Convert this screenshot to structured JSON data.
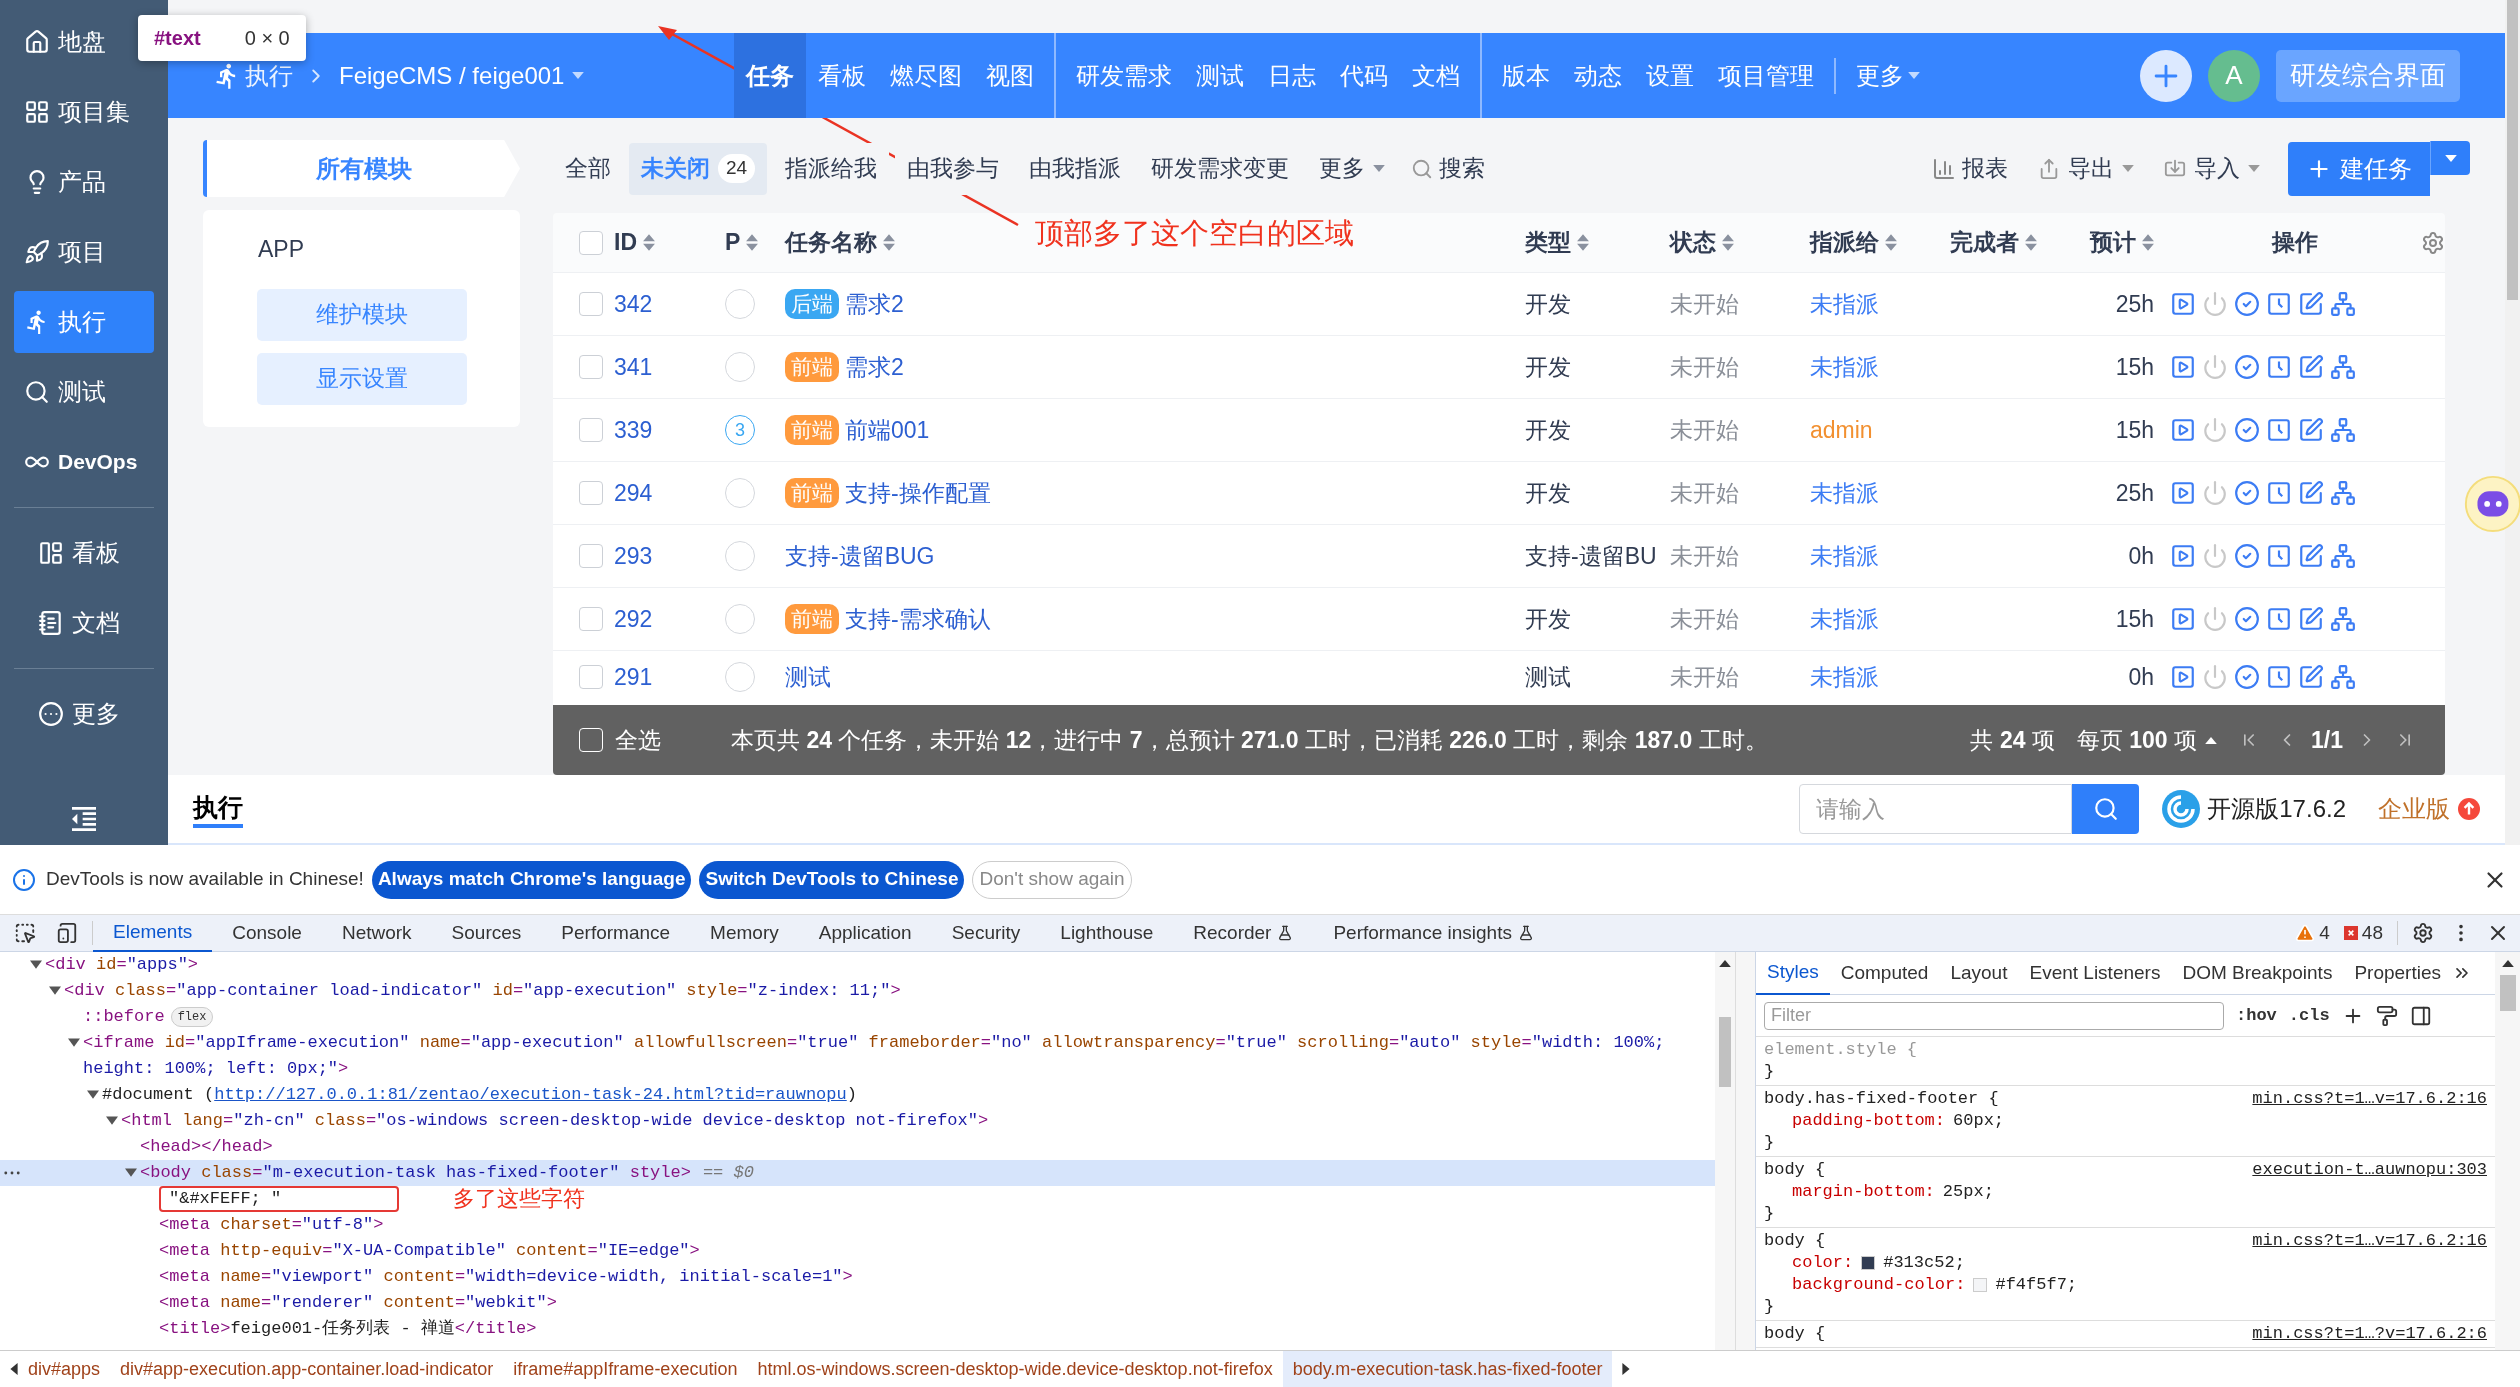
{
  "tooltip": {
    "node": "#text",
    "size": "0 × 0"
  },
  "sidebar": {
    "groups": [
      [
        {
          "label": "地盘",
          "selected": false
        },
        {
          "label": "项目集",
          "selected": false
        },
        {
          "label": "产品",
          "selected": false
        },
        {
          "label": "项目",
          "selected": false
        },
        {
          "label": "执行",
          "selected": true
        },
        {
          "label": "测试",
          "selected": false
        },
        {
          "label": "DevOps",
          "selected": false
        }
      ],
      [
        {
          "label": "看板",
          "selected": false
        },
        {
          "label": "文档",
          "selected": false
        }
      ],
      [
        {
          "label": "更多",
          "selected": false
        }
      ]
    ]
  },
  "header": {
    "module": "执行",
    "project": "FeigeCMS / feige001",
    "nav": [
      [
        {
          "label": "任务",
          "selected": true
        },
        {
          "label": "看板",
          "selected": false
        },
        {
          "label": "燃尽图",
          "selected": false
        },
        {
          "label": "视图",
          "selected": false
        }
      ],
      [
        {
          "label": "研发需求",
          "selected": false
        },
        {
          "label": "测试",
          "selected": false
        },
        {
          "label": "日志",
          "selected": false
        },
        {
          "label": "代码",
          "selected": false
        },
        {
          "label": "文档",
          "selected": false
        }
      ],
      [
        {
          "label": "版本",
          "selected": false
        },
        {
          "label": "动态",
          "selected": false
        },
        {
          "label": "设置",
          "selected": false
        },
        {
          "label": "项目管理",
          "selected": false
        }
      ]
    ],
    "more": "更多",
    "avatar": "A",
    "switch_button": "研发综合界面"
  },
  "annotation": "顶部多了这个空白的区域",
  "modules": {
    "tab": "所有模块",
    "items": [
      "APP"
    ],
    "buttons": [
      "维护模块",
      "显示设置"
    ]
  },
  "filters": [
    {
      "label": "全部",
      "selected": false
    },
    {
      "label": "未关闭",
      "count": "24",
      "selected": true
    },
    {
      "label": "指派给我",
      "selected": false
    },
    {
      "label": "由我参与",
      "selected": false
    },
    {
      "label": "由我指派",
      "selected": false
    },
    {
      "label": "研发需求变更",
      "selected": false
    }
  ],
  "filter_more": "更多",
  "search": "搜索",
  "actions": {
    "report": "报表",
    "export": "导出",
    "import": "导入",
    "create": "建任务"
  },
  "table": {
    "columns": [
      {
        "label": "ID",
        "sortable": true
      },
      {
        "label": "P",
        "sortable": true
      },
      {
        "label": "任务名称",
        "sortable": true
      },
      {
        "label": "类型",
        "sortable": true
      },
      {
        "label": "状态",
        "sortable": true
      },
      {
        "label": "指派给",
        "sortable": true
      },
      {
        "label": "完成者",
        "sortable": true
      },
      {
        "label": "预计",
        "sortable": true
      },
      {
        "label": "操作",
        "sortable": false
      }
    ],
    "select_all_checked": false,
    "rows": [
      {
        "id": "342",
        "checked": false,
        "tag": {
          "label": "后端",
          "color": "#3aa7f2"
        },
        "name": "需求2",
        "type": "开发",
        "status": "未开始",
        "assignee": {
          "name": "未指派",
          "color": "#3c7cf4"
        },
        "estimate": "25h"
      },
      {
        "id": "341",
        "checked": false,
        "tag": {
          "label": "前端",
          "color": "#ff9a3d"
        },
        "name": "需求2",
        "type": "开发",
        "status": "未开始",
        "assignee": {
          "name": "未指派",
          "color": "#3c7cf4"
        },
        "estimate": "15h"
      },
      {
        "id": "339",
        "checked": false,
        "priority": "3",
        "tag": {
          "label": "前端",
          "color": "#ff9a3d"
        },
        "name": "前端001",
        "type": "开发",
        "status": "未开始",
        "assignee": {
          "name": "admin",
          "color": "#f29030"
        },
        "estimate": "15h"
      },
      {
        "id": "294",
        "checked": false,
        "tag": {
          "label": "前端",
          "color": "#ff9a3d"
        },
        "name": "支持-操作配置",
        "type": "开发",
        "status": "未开始",
        "assignee": {
          "name": "未指派",
          "color": "#3c7cf4"
        },
        "estimate": "25h"
      },
      {
        "id": "293",
        "checked": false,
        "name": "支持-遗留BUG",
        "type": "支持-遗留BU",
        "status": "未开始",
        "assignee": {
          "name": "未指派",
          "color": "#3c7cf4"
        },
        "estimate": "0h"
      },
      {
        "id": "292",
        "checked": false,
        "tag": {
          "label": "前端",
          "color": "#ff9a3d"
        },
        "name": "支持-需求确认",
        "type": "开发",
        "status": "未开始",
        "assignee": {
          "name": "未指派",
          "color": "#3c7cf4"
        },
        "estimate": "15h"
      },
      {
        "id": "291",
        "checked": false,
        "name": "测试",
        "type": "测试",
        "status": "未开始",
        "assignee": {
          "name": "未指派",
          "color": "#3c7cf4"
        },
        "estimate": "0h"
      }
    ]
  },
  "table_footer": {
    "select_all": "全选",
    "checked": false,
    "summary": "本页共 **24** 个任务，未开始 **12**，进行中 **7**，总预计 **271.0** 工时，已消耗 **226.0** 工时，剩余 **187.0** 工时。",
    "total": "共 **24** 项",
    "per_page": "每页 **100** 项",
    "page": "1/1"
  },
  "footer": {
    "tab": "执行",
    "search_placeholder": "请输入",
    "edition": "开源版17.6.2",
    "upgrade": "企业版"
  },
  "devtools": {
    "infobar": {
      "message": "DevTools is now available in Chinese!",
      "buttons": [
        {
          "label": "Always match Chrome's language",
          "kind": "primary"
        },
        {
          "label": "Switch DevTools to Chinese",
          "kind": "primary"
        },
        {
          "label": "Don't show again",
          "kind": "secondary"
        }
      ]
    },
    "tabs": [
      {
        "label": "Elements",
        "selected": true
      },
      {
        "label": "Console",
        "selected": false
      },
      {
        "label": "Network",
        "selected": false
      },
      {
        "label": "Sources",
        "selected": false
      },
      {
        "label": "Performance",
        "selected": false
      },
      {
        "label": "Memory",
        "selected": false
      },
      {
        "label": "Application",
        "selected": false
      },
      {
        "label": "Security",
        "selected": false
      },
      {
        "label": "Lighthouse",
        "selected": false
      },
      {
        "label": "Recorder",
        "selected": false,
        "experimental": true
      },
      {
        "label": "Performance insights",
        "selected": false,
        "experimental": true
      }
    ],
    "warnings": "4",
    "errors": "48",
    "dom": [
      {
        "kind": "tag",
        "text": "<div id=\"apps\">",
        "expanded": true,
        "children": [
          {
            "kind": "tag",
            "text": "<div class=\"app-container load-indicator\" id=\"app-execution\" style=\"z-index: 11;\">",
            "expanded": true,
            "children": [
              {
                "kind": "pseudo",
                "text": "::before",
                "badge": "flex"
              },
              {
                "kind": "tag",
                "text": "<iframe id=\"appIframe-execution\" name=\"app-execution\" allowfullscreen=\"true\" frameborder=\"no\" allowtransparency=\"true\" scrolling=\"auto\" style=\"width: 100%; height: 100%; left: 0px;\">",
                "expanded": true,
                "children": [
                  {
                    "kind": "document",
                    "text": "#document (",
                    "link": "http://127.0.0.1:81/zentao/execution-task-24.html?tid=rauwnopu",
                    "end": ")",
                    "expanded": true,
                    "children": [
                      {
                        "kind": "tag",
                        "text": "<html lang=\"zh-cn\" class=\"os-windows screen-desktop-wide device-desktop not-firefox\">",
                        "expanded": true,
                        "children": [
                          {
                            "kind": "tag",
                            "text": "<head></head>"
                          },
                          {
                            "kind": "tag",
                            "text": "<body class=\"m-execution-task has-fixed-footer\" style>",
                            "suffix": "== $0",
                            "selected": true,
                            "expanded": true,
                            "children": [
                              {
                                "kind": "text",
                                "text": "\"&#xFEFF; \"",
                                "highlight": true,
                                "note": "多了这些字符"
                              },
                              {
                                "kind": "tag",
                                "text": "<meta charset=\"utf-8\">"
                              },
                              {
                                "kind": "tag",
                                "text": "<meta http-equiv=\"X-UA-Compatible\" content=\"IE=edge\">"
                              },
                              {
                                "kind": "tag",
                                "text": "<meta name=\"viewport\" content=\"width=device-width, initial-scale=1\">"
                              },
                              {
                                "kind": "tag",
                                "text": "<meta name=\"renderer\" content=\"webkit\">"
                              },
                              {
                                "kind": "tag",
                                "text": "<title>feige001-任务列表 - 禅道</title>"
                              }
                            ]
                          }
                        ]
                      }
                    ]
                  }
                ]
              }
            ]
          }
        ]
      }
    ],
    "styles_tabs": [
      {
        "label": "Styles",
        "selected": true
      },
      {
        "label": "Computed",
        "selected": false
      },
      {
        "label": "Layout",
        "selected": false
      },
      {
        "label": "Event Listeners",
        "selected": false
      },
      {
        "label": "DOM Breakpoints",
        "selected": false
      },
      {
        "label": "Properties",
        "selected": false
      }
    ],
    "filter_placeholder": "Filter",
    "toggles": [
      ":hov",
      ".cls"
    ],
    "rules": [
      {
        "selector": "element.style {",
        "kind": "inline",
        "close": "}"
      },
      {
        "selector": "body.has-fixed-footer {",
        "source": "min.css?t=1…v=17.6.2:16",
        "close": "}",
        "props": [
          {
            "name": "padding-bottom:",
            "value": "60px;"
          }
        ]
      },
      {
        "selector": "body {",
        "source": "execution-t…auwnopu:303",
        "close": "}",
        "props": [
          {
            "name": "margin-bottom:",
            "value": "25px;"
          }
        ]
      },
      {
        "selector": "body {",
        "source": "min.css?t=1…v=17.6.2:16",
        "close": "}",
        "props": [
          {
            "name": "color:",
            "value": "#313c52;",
            "color": "#313c52"
          },
          {
            "name": "background-color:",
            "value": "#f4f5f7;",
            "color": "#f4f5f7"
          }
        ]
      },
      {
        "selector": "body {",
        "source": "min.css?t=1…?v=17.6.2:6"
      }
    ],
    "breadcrumb": [
      {
        "label": "div#apps",
        "selected": false
      },
      {
        "label": "div#app-execution.app-container.load-indicator",
        "selected": false
      },
      {
        "label": "iframe#appIframe-execution",
        "selected": false
      },
      {
        "label": "html.os-windows.screen-desktop-wide.device-desktop.not-firefox",
        "selected": false
      },
      {
        "label": "body.m-execution-task.has-fixed-footer",
        "selected": true
      }
    ]
  }
}
